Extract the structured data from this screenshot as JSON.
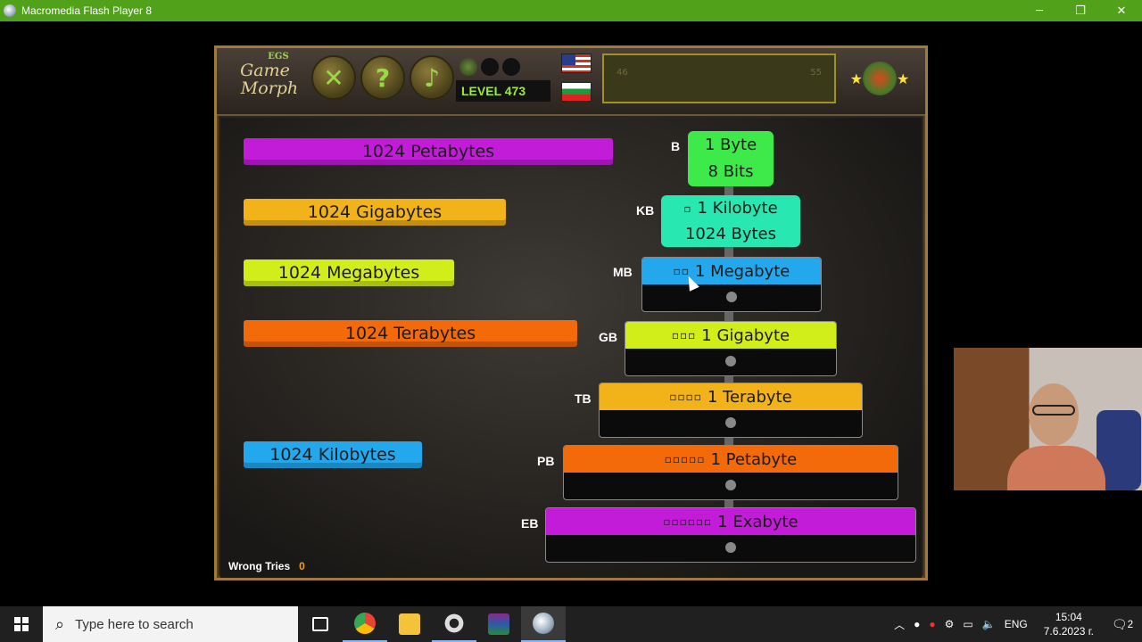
{
  "window": {
    "title": "Macromedia Flash Player 8",
    "minimize": "─",
    "restore": "❐",
    "close": "✕"
  },
  "game": {
    "logo_tag": "EGS",
    "logo_line1": "Game",
    "logo_line2": "Morph",
    "level_label": "LEVEL 473",
    "minimap_left": "46",
    "minimap_right": "55",
    "toolbar": {
      "tools_glyph": "✕",
      "help_glyph": "?",
      "music_glyph": "♪"
    },
    "colors": {
      "purple": "#c21cd8",
      "gold": "#f2b31a",
      "lime": "#d2ee1a",
      "orange": "#f26a0a",
      "blue": "#23a8ee",
      "green": "#3eea4a",
      "teal": "#28e7b0"
    },
    "draggables": [
      {
        "label": "1024 Petabytes",
        "color": "#c21cd8"
      },
      {
        "label": "1024 Gigabytes",
        "color": "#f2b31a"
      },
      {
        "label": "1024 Megabytes",
        "color": "#d2ee1a"
      },
      {
        "label": "1024 Terabytes",
        "color": "#f26a0a"
      },
      {
        "label": "1024 Kilobytes",
        "color": "#23a8ee"
      }
    ],
    "units": [
      {
        "prefix": "B",
        "marks": "",
        "title": "1 Byte",
        "subtitle": "8 Bits",
        "color": "#3eea4a"
      },
      {
        "prefix": "KB",
        "marks": "▫",
        "title": "1 Kilobyte",
        "subtitle": "1024 Bytes",
        "color": "#28e7b0"
      },
      {
        "prefix": "MB",
        "marks": "▫▫",
        "title": "1 Megabyte",
        "subtitle": "",
        "color": "#23a8ee"
      },
      {
        "prefix": "GB",
        "marks": "▫▫▫",
        "title": "1 Gigabyte",
        "subtitle": "",
        "color": "#d2ee1a"
      },
      {
        "prefix": "TB",
        "marks": "▫▫▫▫",
        "title": "1 Terabyte",
        "subtitle": "",
        "color": "#f2b31a"
      },
      {
        "prefix": "PB",
        "marks": "▫▫▫▫▫",
        "title": "1 Petabyte",
        "subtitle": "",
        "color": "#f26a0a"
      },
      {
        "prefix": "EB",
        "marks": "▫▫▫▫▫▫",
        "title": "1 Exabyte",
        "subtitle": "",
        "color": "#c21cd8"
      }
    ],
    "wrong_tries_label": "Wrong Tries",
    "wrong_tries_count": "0"
  },
  "taskbar": {
    "search_placeholder": "Type here to search",
    "language": "ENG",
    "time": "15:04",
    "date": "7.6.2023 г.",
    "notification_count": "2"
  }
}
